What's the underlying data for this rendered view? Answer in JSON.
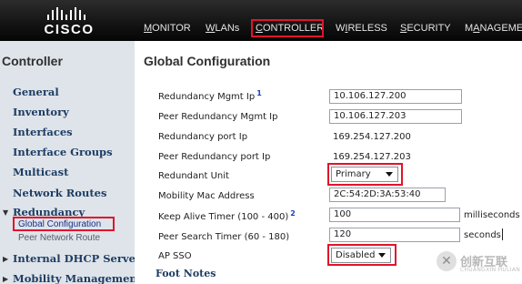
{
  "header": {
    "logo_text": "CISCO",
    "nav": [
      {
        "prefix": "",
        "u": "M",
        "rest": "ONITOR"
      },
      {
        "prefix": "",
        "u": "W",
        "rest": "LANs"
      },
      {
        "prefix": "",
        "u": "C",
        "rest": "ONTROLLER"
      },
      {
        "prefix": "W",
        "u": "I",
        "rest": "RELESS"
      },
      {
        "prefix": "",
        "u": "S",
        "rest": "ECURITY"
      },
      {
        "prefix": "M",
        "u": "A",
        "rest": "NAGEME"
      }
    ],
    "active_nav": "CONTROLLER"
  },
  "sidebar": {
    "title": "Controller",
    "items": [
      {
        "label": "General"
      },
      {
        "label": "Inventory"
      },
      {
        "label": "Interfaces"
      },
      {
        "label": "Interface Groups"
      },
      {
        "label": "Multicast"
      },
      {
        "label": "Network Routes"
      },
      {
        "label": "Redundancy"
      },
      {
        "label": "Internal DHCP Server"
      },
      {
        "label": "Mobility Management"
      }
    ],
    "redundancy_sub": [
      {
        "label": "Global Configuration"
      },
      {
        "label": "Peer Network Route"
      }
    ]
  },
  "main": {
    "title": "Global Configuration",
    "rows": [
      {
        "label": "Redundancy Mgmt Ip",
        "footnote": "1",
        "value": "10.106.127.200"
      },
      {
        "label": "Peer Redundancy Mgmt Ip",
        "value": "10.106.127.203"
      },
      {
        "label": "Redundancy port Ip",
        "value": "169.254.127.200"
      },
      {
        "label": "Peer Redundancy port Ip",
        "value": "169.254.127.203"
      },
      {
        "label": "Redundant Unit",
        "value": "Primary"
      },
      {
        "label": "Mobility Mac Address",
        "value": "2C:54:2D:3A:53:40"
      },
      {
        "label": "Keep Alive Timer (100 - 400)",
        "footnote": "2",
        "value": "100",
        "unit": "milliseconds"
      },
      {
        "label": "Peer Search Timer (60 - 180)",
        "value": "120",
        "unit": "seconds"
      },
      {
        "label": "AP SSO",
        "value": "Disabled"
      }
    ],
    "footnotes_label": "Foot Notes"
  },
  "watermark": {
    "text": "创新互联",
    "sub": "CHUANGXIN HULIAN"
  },
  "colors": {
    "highlight": "#e0142a",
    "header_bg": "#151515",
    "sidebar_bg": "#dfe4ea",
    "link": "#1d3d63"
  }
}
